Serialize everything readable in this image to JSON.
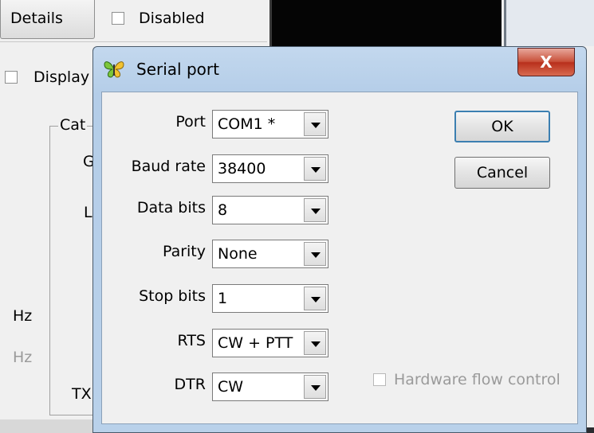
{
  "background": {
    "details_tab": "Details",
    "disabled_label": "Disabled",
    "display_label": "Display",
    "cat_label": "Cat",
    "g_label": "G",
    "l_label": "L",
    "hz_label_1": "Hz",
    "hz_label_2": "Hz",
    "tx_label": "TX"
  },
  "dialog": {
    "title": "Serial port",
    "close_label": "X",
    "fields": [
      {
        "label": "Port",
        "value": "COM1 *"
      },
      {
        "label": "Baud rate",
        "value": "38400"
      },
      {
        "label": "Data bits",
        "value": "8"
      },
      {
        "label": "Parity",
        "value": "None"
      },
      {
        "label": "Stop bits",
        "value": "1"
      },
      {
        "label": "RTS",
        "value": "CW + PTT"
      },
      {
        "label": "DTR",
        "value": "CW"
      }
    ],
    "ok_label": "OK",
    "cancel_label": "Cancel",
    "hardware_flow_label": "Hardware flow control",
    "hardware_flow_checked": false
  }
}
